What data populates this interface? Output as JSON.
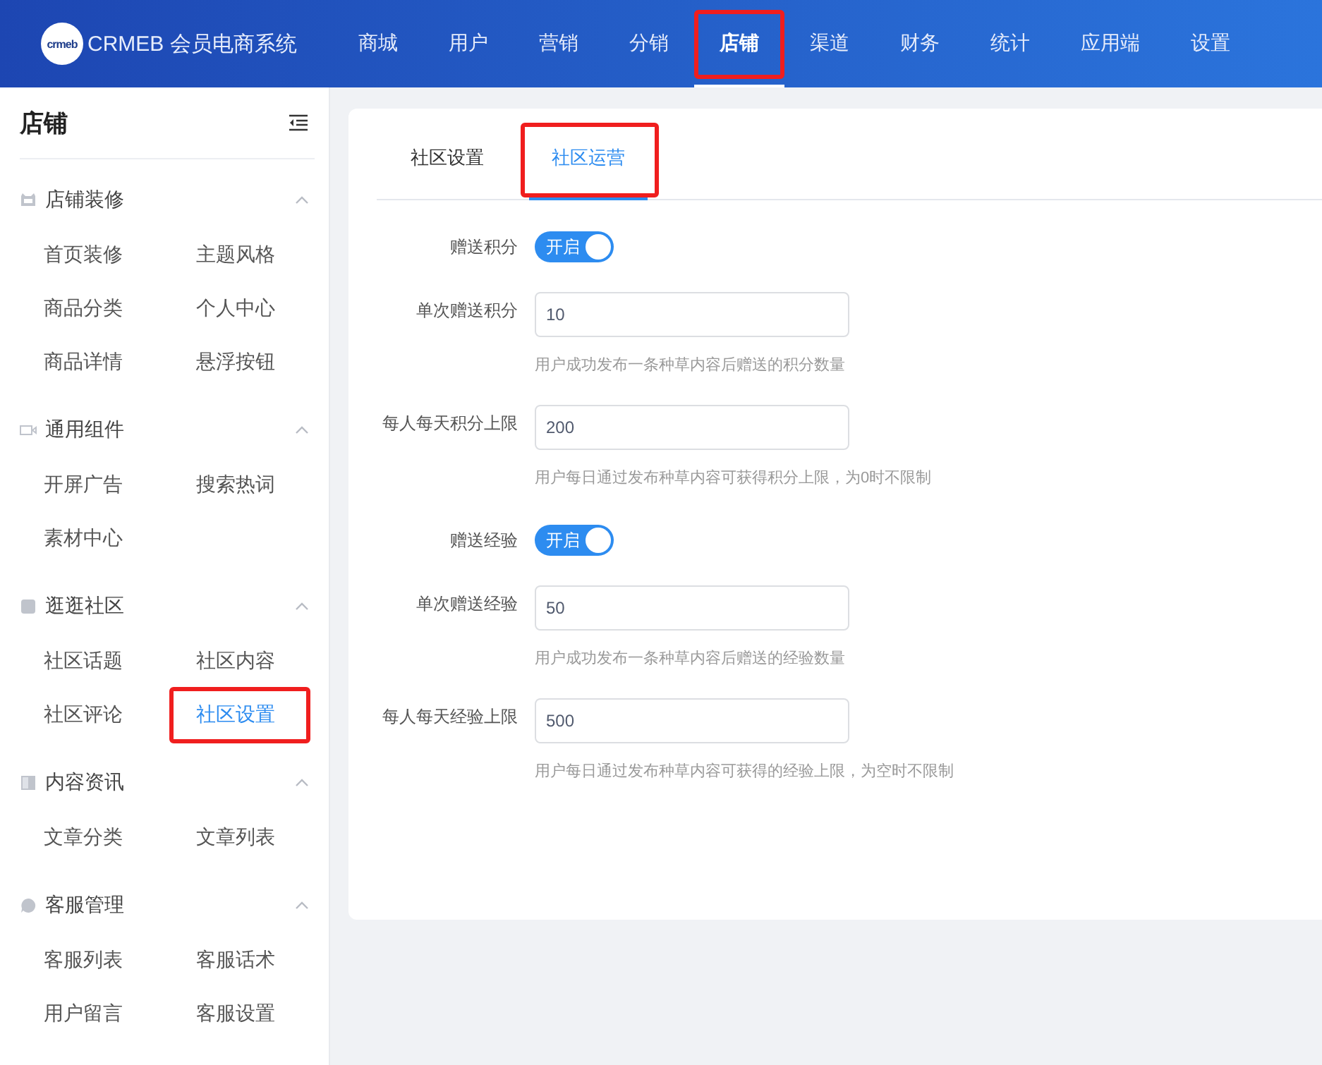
{
  "header": {
    "logo_text": "crmeb",
    "brand": "CRMEB 会员电商系统",
    "nav": [
      {
        "label": "商城",
        "selected": false,
        "highlighted": false
      },
      {
        "label": "用户",
        "selected": false,
        "highlighted": false
      },
      {
        "label": "营销",
        "selected": false,
        "highlighted": false
      },
      {
        "label": "分销",
        "selected": false,
        "highlighted": false
      },
      {
        "label": "店铺",
        "selected": true,
        "highlighted": true
      },
      {
        "label": "渠道",
        "selected": false,
        "highlighted": false
      },
      {
        "label": "财务",
        "selected": false,
        "highlighted": false
      },
      {
        "label": "统计",
        "selected": false,
        "highlighted": false
      },
      {
        "label": "应用端",
        "selected": false,
        "highlighted": false
      },
      {
        "label": "设置",
        "selected": false,
        "highlighted": false
      }
    ]
  },
  "sidebar": {
    "title": "店铺",
    "groups": [
      {
        "label": "店铺装修",
        "expanded": true,
        "items": [
          {
            "label": "首页装修",
            "selected": false,
            "highlighted": false
          },
          {
            "label": "主题风格",
            "selected": false,
            "highlighted": false
          },
          {
            "label": "商品分类",
            "selected": false,
            "highlighted": false
          },
          {
            "label": "个人中心",
            "selected": false,
            "highlighted": false
          },
          {
            "label": "商品详情",
            "selected": false,
            "highlighted": false
          },
          {
            "label": "悬浮按钮",
            "selected": false,
            "highlighted": false
          }
        ]
      },
      {
        "label": "通用组件",
        "expanded": true,
        "items": [
          {
            "label": "开屏广告",
            "selected": false,
            "highlighted": false
          },
          {
            "label": "搜索热词",
            "selected": false,
            "highlighted": false
          },
          {
            "label": "素材中心",
            "selected": false,
            "highlighted": false
          }
        ]
      },
      {
        "label": "逛逛社区",
        "expanded": true,
        "items": [
          {
            "label": "社区话题",
            "selected": false,
            "highlighted": false
          },
          {
            "label": "社区内容",
            "selected": false,
            "highlighted": false
          },
          {
            "label": "社区评论",
            "selected": false,
            "highlighted": false
          },
          {
            "label": "社区设置",
            "selected": true,
            "highlighted": true
          }
        ]
      },
      {
        "label": "内容资讯",
        "expanded": true,
        "items": [
          {
            "label": "文章分类",
            "selected": false,
            "highlighted": false
          },
          {
            "label": "文章列表",
            "selected": false,
            "highlighted": false
          }
        ]
      },
      {
        "label": "客服管理",
        "expanded": true,
        "items": [
          {
            "label": "客服列表",
            "selected": false,
            "highlighted": false
          },
          {
            "label": "客服话术",
            "selected": false,
            "highlighted": false
          },
          {
            "label": "用户留言",
            "selected": false,
            "highlighted": false
          },
          {
            "label": "客服设置",
            "selected": false,
            "highlighted": false
          }
        ]
      }
    ]
  },
  "tabs": [
    {
      "label": "社区设置",
      "selected": false,
      "highlighted": false
    },
    {
      "label": "社区运营",
      "selected": true,
      "highlighted": true
    }
  ],
  "form": [
    {
      "kind": "toggle",
      "label": "赠送积分",
      "on": true,
      "text": "开启"
    },
    {
      "kind": "input",
      "label": "单次赠送积分",
      "value": "10",
      "hint": "用户成功发布一条种草内容后赠送的积分数量"
    },
    {
      "kind": "input",
      "label": "每人每天积分上限",
      "value": "200",
      "hint": "用户每日通过发布种草内容可获得积分上限，为0时不限制"
    },
    {
      "kind": "toggle",
      "label": "赠送经验",
      "on": true,
      "text": "开启"
    },
    {
      "kind": "input",
      "label": "单次赠送经验",
      "value": "50",
      "hint": "用户成功发布一条种草内容后赠送的经验数量"
    },
    {
      "kind": "input",
      "label": "每人每天经验上限",
      "value": "500",
      "hint": "用户每日通过发布种草内容可获得的经验上限，为空时不限制"
    }
  ]
}
